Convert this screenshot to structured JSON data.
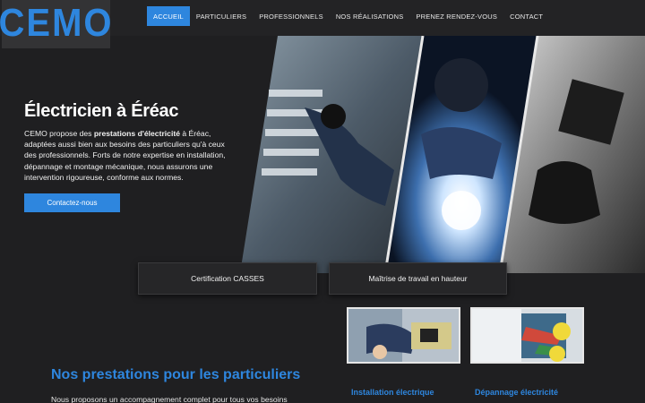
{
  "brand": {
    "logo": "CEMO",
    "accent": "#2e86de"
  },
  "nav": {
    "items": [
      {
        "label": "ACCUEIL",
        "active": true
      },
      {
        "label": "PARTICULIERS"
      },
      {
        "label": "PROFESSIONNELS"
      },
      {
        "label": "NOS RÉALISATIONS"
      },
      {
        "label": "PRENEZ RENDEZ-VOUS"
      },
      {
        "label": "CONTACT"
      }
    ]
  },
  "hero": {
    "title": "Électricien à Éréac",
    "text_before": "CEMO propose des ",
    "text_bold": "prestations d'électricité",
    "text_after": " à Éréac, adaptées aussi bien aux besoins des particuliers qu'à ceux des professionnels. Forts de notre expertise en installation, dépannage et montage mécanique, nous assurons une intervention rigoureuse, conforme aux normes.",
    "cta": "Contactez-nous"
  },
  "cards": {
    "certification": "Certification CASSES",
    "height_work": "Maîtrise de travail en hauteur"
  },
  "services": {
    "title": "Nos prestations pour les particuliers",
    "text_before": "Nous proposons un accompagnement complet pour tous vos ",
    "text_underlined": "besoins",
    "items": [
      {
        "caption": "Installation électrique"
      },
      {
        "caption": "Dépannage électricité"
      }
    ]
  }
}
